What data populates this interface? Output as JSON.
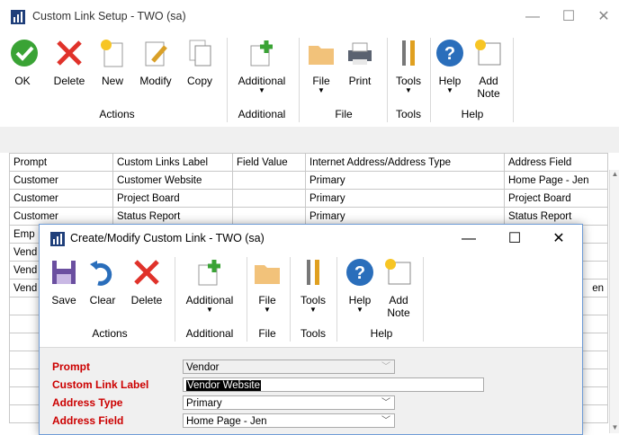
{
  "window": {
    "title": "Custom Link Setup  -  TWO (sa)"
  },
  "ribbon": {
    "buttons": [
      {
        "label": "OK"
      },
      {
        "label": "Delete"
      },
      {
        "label": "New"
      },
      {
        "label": "Modify"
      },
      {
        "label": "Copy"
      },
      {
        "label": "Additional"
      },
      {
        "label": "File"
      },
      {
        "label": "Print"
      },
      {
        "label": "Tools"
      },
      {
        "label": "Help"
      },
      {
        "label": "Add",
        "label2": "Note"
      }
    ],
    "groups": [
      "Actions",
      "Additional",
      "File",
      "Tools",
      "Help"
    ]
  },
  "grid": {
    "columns": [
      "Prompt",
      "Custom Links Label",
      "Field Value",
      "Internet Address/Address Type",
      "Address Field"
    ],
    "rows": [
      [
        "Customer",
        "Customer Website",
        "",
        "Primary",
        "Home Page - Jen"
      ],
      [
        "Customer",
        "Project Board",
        "",
        "Primary",
        "Project Board"
      ],
      [
        "Customer",
        "Status Report",
        "",
        "Primary",
        "Status Report"
      ],
      [
        "Emp",
        "",
        "",
        "",
        ""
      ],
      [
        "Vend",
        "",
        "",
        "",
        ""
      ],
      [
        "Vend",
        "",
        "",
        "",
        ""
      ],
      [
        "Vend",
        "",
        "",
        "",
        "en"
      ]
    ]
  },
  "dialog": {
    "title": "Create/Modify Custom Link  -  TWO (sa)",
    "buttons": [
      {
        "label": "Save"
      },
      {
        "label": "Clear"
      },
      {
        "label": "Delete"
      },
      {
        "label": "Additional"
      },
      {
        "label": "File"
      },
      {
        "label": "Tools"
      },
      {
        "label": "Help"
      },
      {
        "label": "Add",
        "label2": "Note"
      }
    ],
    "groups": [
      "Actions",
      "Additional",
      "File",
      "Tools",
      "Help"
    ],
    "form": {
      "prompt_label": "Prompt",
      "prompt_value": "Vendor",
      "custom_link_label": "Custom Link Label",
      "custom_link_value": "Vendor Website",
      "address_type_label": "Address Type",
      "address_type_value": "Primary",
      "address_field_label": "Address Field",
      "address_field_value": "Home Page - Jen"
    }
  },
  "colors": {
    "required_label": "#cc0000",
    "accent": "#2a6ebb"
  }
}
